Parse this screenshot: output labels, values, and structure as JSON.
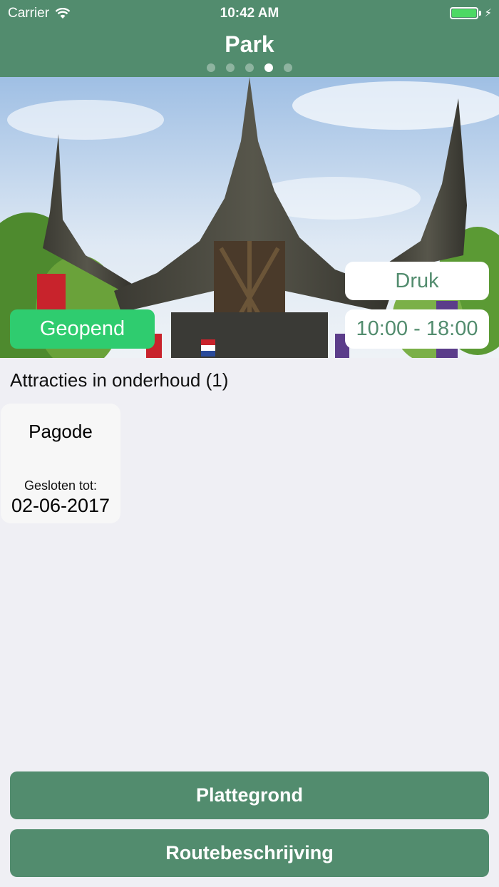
{
  "status_bar": {
    "carrier": "Carrier",
    "time": "10:42 AM"
  },
  "header": {
    "title": "Park",
    "page_count": 5,
    "active_page": 4
  },
  "hero": {
    "status": "Geopend",
    "crowd": "Druk",
    "hours": "10:00 - 18:00"
  },
  "maintenance": {
    "title": "Attracties in onderhoud (1)",
    "items": [
      {
        "name": "Pagode",
        "closed_label": "Gesloten tot:",
        "date": "02-06-2017"
      }
    ]
  },
  "buttons": {
    "map": "Plattegrond",
    "route": "Routebeschrijving"
  },
  "colors": {
    "brand": "#528c6e",
    "open": "#2fcc6f",
    "background": "#efeff4"
  }
}
